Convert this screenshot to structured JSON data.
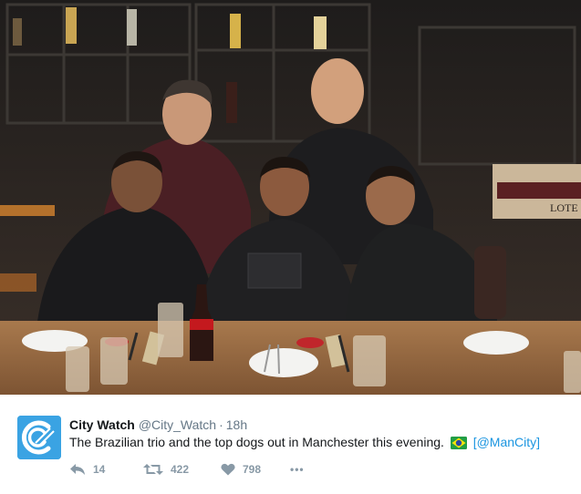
{
  "tweet": {
    "display_name": "City Watch",
    "handle": "@City_Watch",
    "separator": "·",
    "time": "18h",
    "text": "The Brazilian trio and the top dogs out in Manchester this evening.",
    "link_open": "[",
    "link": "@ManCity",
    "link_close": "]",
    "flag_icon": "brazil-flag-emoji",
    "avatar_icon": "city-watch-logo"
  },
  "photo": {
    "subject": "Five men posing at a restaurant table",
    "crate_label": "LOTE"
  },
  "actions": {
    "reply": {
      "icon": "reply-icon",
      "count": "14"
    },
    "retweet": {
      "icon": "retweet-icon",
      "count": "422"
    },
    "like": {
      "icon": "heart-icon",
      "count": "798"
    },
    "more": {
      "icon": "more-icon",
      "label": "•••"
    }
  },
  "colors": {
    "accent": "#1b95e0",
    "avatar_bg": "#3aa3e3",
    "text": "#14171a",
    "muted": "#657786"
  }
}
